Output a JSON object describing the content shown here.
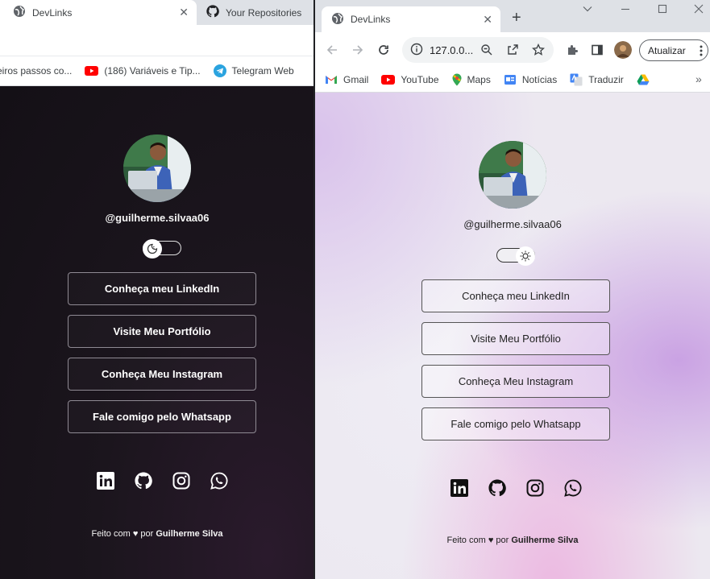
{
  "left_window": {
    "active_tab": {
      "title": "DevLinks",
      "icon": "globe-icon"
    },
    "inactive_tab": {
      "title": "Your Repositories",
      "icon": "github-icon"
    },
    "bookmarks": [
      {
        "label": "eiros passos co...",
        "icon": ""
      },
      {
        "label": "(186) Variáveis e Tip...",
        "icon": "youtube-icon"
      },
      {
        "label": "Telegram Web",
        "icon": "telegram-icon"
      }
    ],
    "page": {
      "theme": "dark",
      "handle": "@guilherme.silvaa06",
      "links": [
        "Conheça meu LinkedIn",
        "Visite Meu Portfólio",
        "Conheça Meu Instagram",
        "Fale comigo pelo Whatsapp"
      ],
      "footer_prefix": "Feito com ♥ por",
      "footer_author": "Guilherme Silva"
    }
  },
  "right_window": {
    "active_tab": {
      "title": "DevLinks",
      "icon": "globe-icon"
    },
    "address": "127.0.0...",
    "update_label": "Atualizar",
    "bookmarks": [
      {
        "label": "Gmail",
        "icon": "gmail-icon"
      },
      {
        "label": "YouTube",
        "icon": "youtube-icon"
      },
      {
        "label": "Maps",
        "icon": "maps-icon"
      },
      {
        "label": "Notícias",
        "icon": "news-icon"
      },
      {
        "label": "Traduzir",
        "icon": "translate-icon"
      }
    ],
    "page": {
      "theme": "light",
      "handle": "@guilherme.silvaa06",
      "links": [
        "Conheça meu LinkedIn",
        "Visite Meu Portfólio",
        "Conheça Meu Instagram",
        "Fale comigo pelo Whatsapp"
      ],
      "footer_prefix": "Feito com ♥ por",
      "footer_author": "Guilherme Silva"
    }
  },
  "social_icons": [
    "linkedin-icon",
    "github-icon",
    "instagram-icon",
    "whatsapp-icon"
  ]
}
